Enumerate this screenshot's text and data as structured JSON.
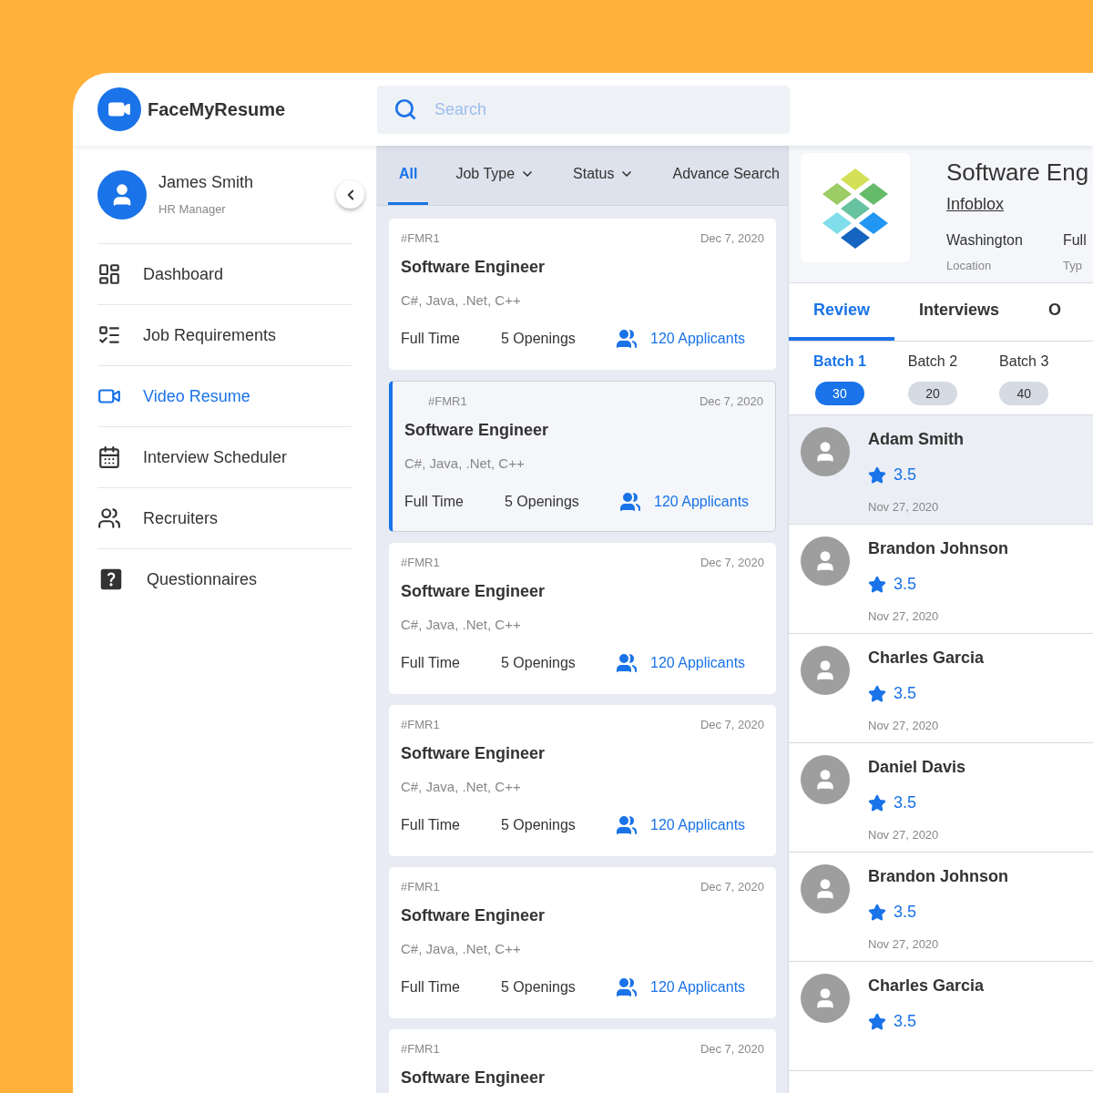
{
  "brand": "FaceMyResume",
  "search": {
    "placeholder": "Search"
  },
  "user": {
    "name": "James Smith",
    "role": "HR Manager"
  },
  "nav": [
    {
      "label": "Dashboard",
      "selected": false
    },
    {
      "label": "Job Requirements",
      "selected": false
    },
    {
      "label": "Video Resume",
      "selected": true
    },
    {
      "label": "Interview Scheduler",
      "selected": false
    },
    {
      "label": "Recruiters",
      "selected": false
    },
    {
      "label": "Questionnaires",
      "selected": false
    }
  ],
  "filters": [
    {
      "label": "All",
      "selected": true,
      "dropdown": false
    },
    {
      "label": "Job Type",
      "selected": false,
      "dropdown": true
    },
    {
      "label": "Status",
      "selected": false,
      "dropdown": true
    },
    {
      "label": "Advance Search",
      "selected": false,
      "dropdown": false
    }
  ],
  "jobs": [
    {
      "code": "#FMR1",
      "date": "Dec 7, 2020",
      "title": "Software Engineer",
      "skills": "C#, Java, .Net, C++",
      "type": "Full Time",
      "openings": "5 Openings",
      "applicants": "120 Applicants",
      "selected": false
    },
    {
      "code": "#FMR1",
      "date": "Dec 7, 2020",
      "title": "Software Engineer",
      "skills": "C#, Java, .Net, C++",
      "type": "Full Time",
      "openings": "5 Openings",
      "applicants": "120 Applicants",
      "selected": true
    },
    {
      "code": "#FMR1",
      "date": "Dec 7, 2020",
      "title": "Software Engineer",
      "skills": "C#, Java, .Net, C++",
      "type": "Full Time",
      "openings": "5 Openings",
      "applicants": "120 Applicants",
      "selected": false
    },
    {
      "code": "#FMR1",
      "date": "Dec 7, 2020",
      "title": "Software Engineer",
      "skills": "C#, Java, .Net, C++",
      "type": "Full Time",
      "openings": "5 Openings",
      "applicants": "120 Applicants",
      "selected": false
    },
    {
      "code": "#FMR1",
      "date": "Dec 7, 2020",
      "title": "Software Engineer",
      "skills": "C#, Java, .Net, C++",
      "type": "Full Time",
      "openings": "5 Openings",
      "applicants": "120 Applicants",
      "selected": false
    },
    {
      "code": "#FMR1",
      "date": "Dec 7, 2020",
      "title": "Software Engineer",
      "selected": false
    }
  ],
  "detail": {
    "title": "Software Eng",
    "company": "Infoblox",
    "facts": [
      {
        "value": "Washington",
        "label": "Location"
      },
      {
        "value": "Full",
        "label": "Typ"
      }
    ],
    "tabs": [
      {
        "label": "Review",
        "selected": true
      },
      {
        "label": "Interviews",
        "selected": false
      },
      {
        "label": "O",
        "selected": false
      }
    ],
    "batches": [
      {
        "label": "Batch 1",
        "count": "30",
        "selected": true
      },
      {
        "label": "Batch 2",
        "count": "20",
        "selected": false
      },
      {
        "label": "Batch 3",
        "count": "40",
        "selected": false
      }
    ],
    "candidates": [
      {
        "name": "Adam Smith",
        "rating": "3.5",
        "date": "Nov 27, 2020",
        "selected": true
      },
      {
        "name": "Brandon Johnson",
        "rating": "3.5",
        "date": "Nov 27, 2020",
        "selected": false
      },
      {
        "name": "Charles Garcia",
        "rating": "3.5",
        "date": "Nov 27, 2020",
        "selected": false
      },
      {
        "name": "Daniel Davis",
        "rating": "3.5",
        "date": "Nov 27, 2020",
        "selected": false
      },
      {
        "name": "Brandon Johnson",
        "rating": "3.5",
        "date": "Nov 27, 2020",
        "selected": false
      },
      {
        "name": "Charles Garcia",
        "rating": "3.5",
        "selected": false
      }
    ]
  }
}
